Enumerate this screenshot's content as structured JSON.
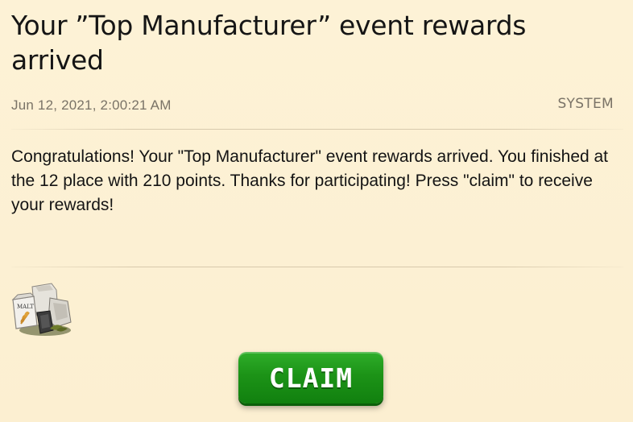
{
  "message": {
    "title": "Your ”Top Manufacturer” event rewards arrived",
    "date": "Jun 12, 2021, 2:00:21 AM",
    "sender": "SYSTEM",
    "body": "Congratulations! Your \"Top Manufacturer\" event rewards arrived. You finished at the 12 place with 210 points. Thanks for participating! Press \"claim\" to receive your rewards!"
  },
  "reward": {
    "icon": "malt-sack-bundle-icon",
    "sack_label": "MALT"
  },
  "actions": {
    "claim_label": "CLAIM"
  },
  "colors": {
    "background": "#fdf1d4",
    "claim_button": "#1c9317",
    "meta_text": "#7a7367"
  }
}
